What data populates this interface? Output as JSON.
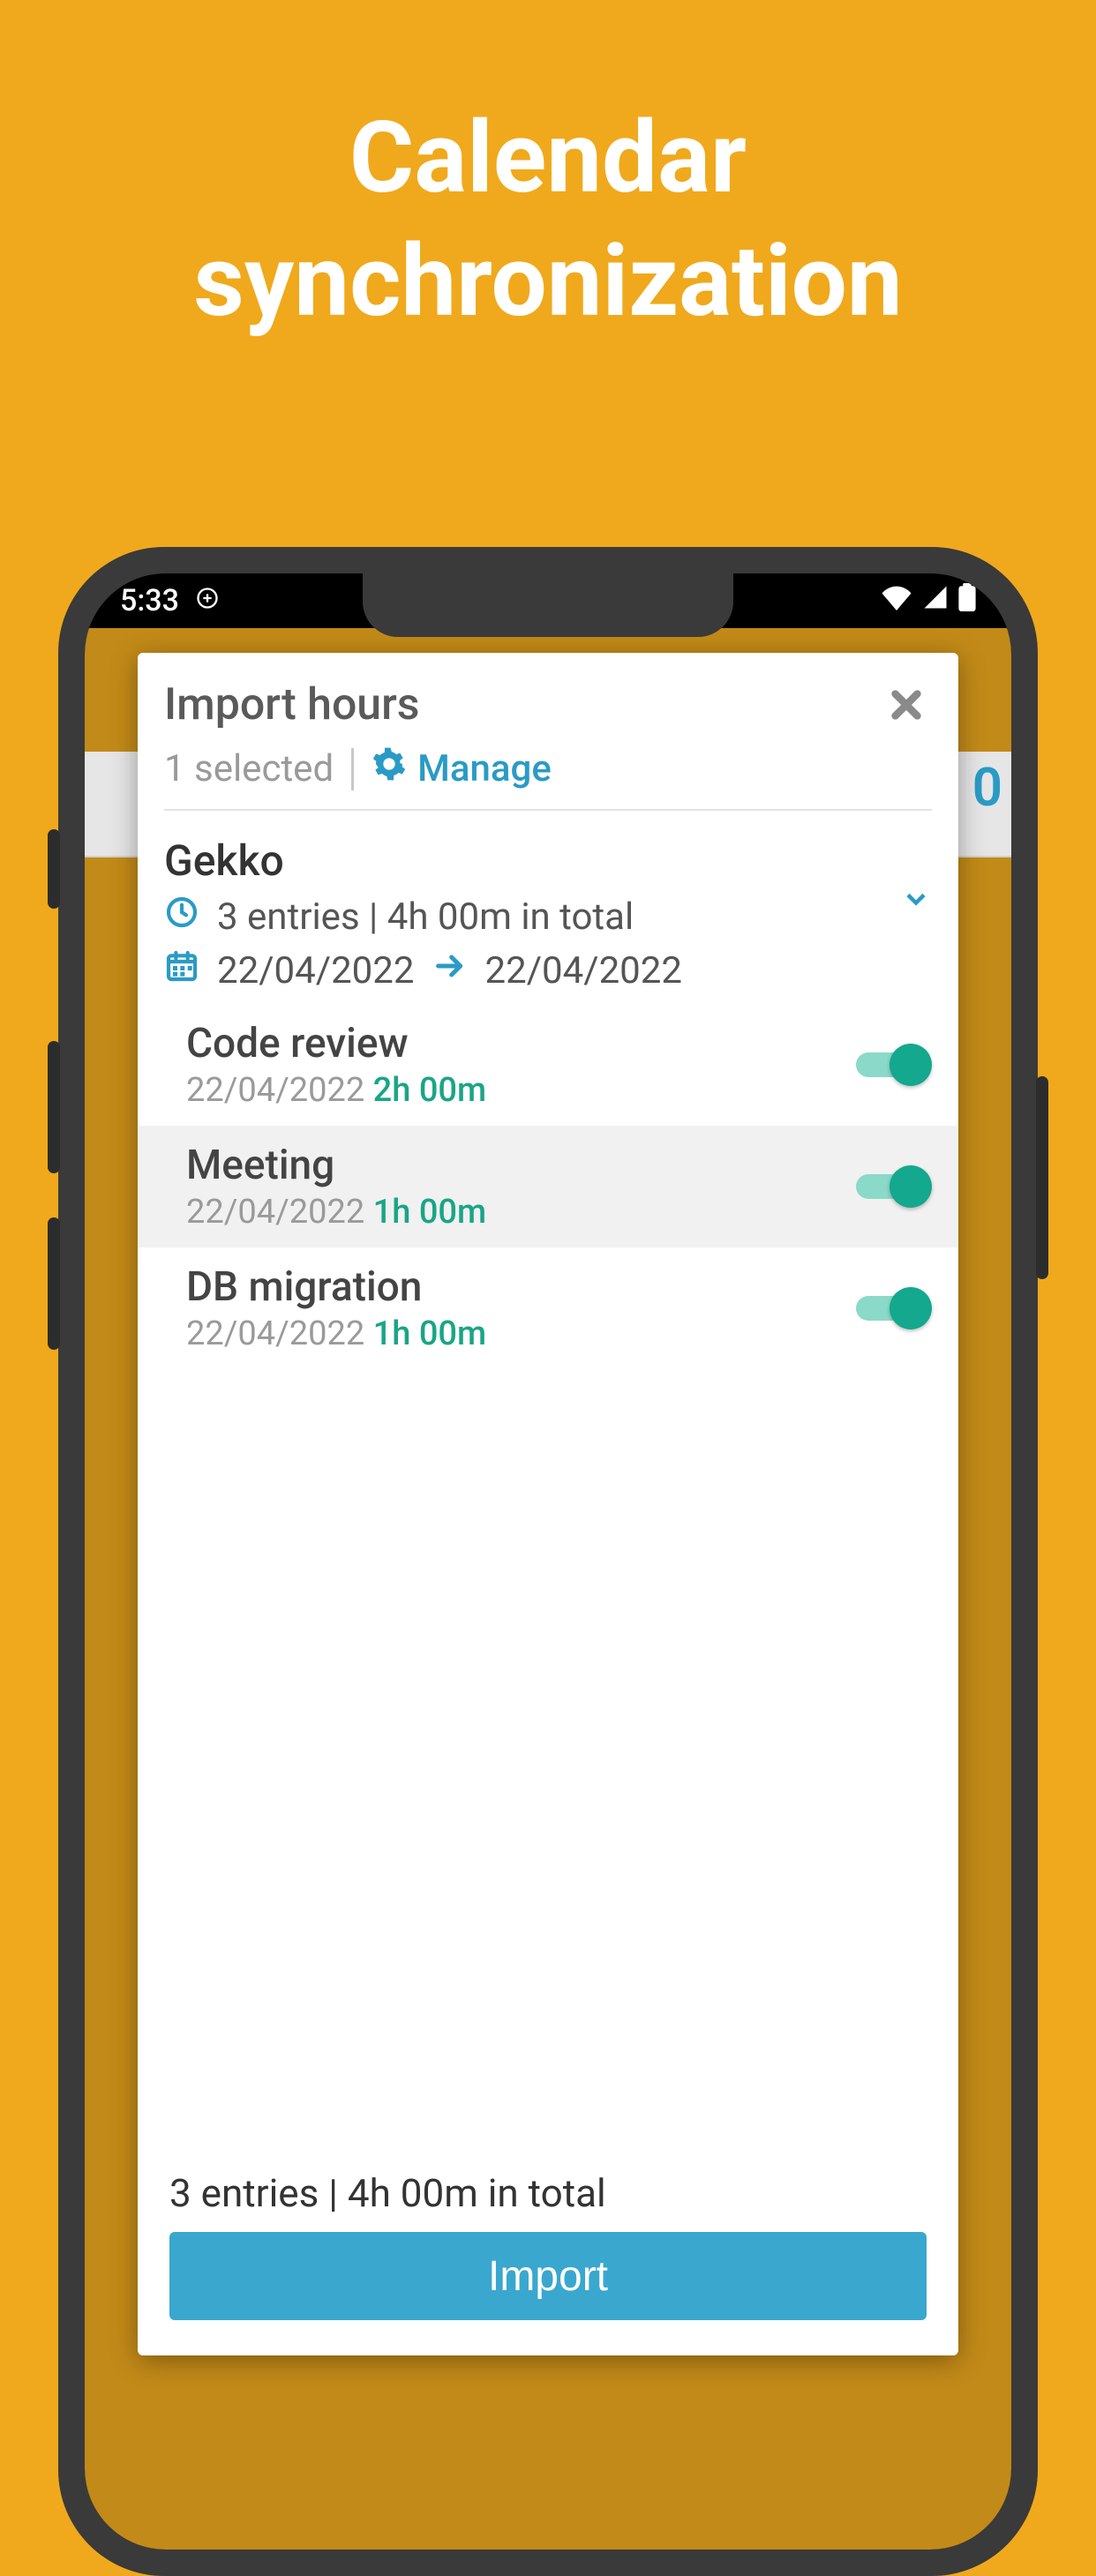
{
  "hero": {
    "line1": "Calendar",
    "line2": "synchronization"
  },
  "status_bar": {
    "time": "5:33"
  },
  "modal": {
    "title": "Import hours",
    "selected_text": "1 selected",
    "manage_label": "Manage",
    "project": {
      "name": "Gekko",
      "summary": "3 entries | 4h 00m in total",
      "date_from": "22/04/2022",
      "date_to": "22/04/2022"
    },
    "entries": [
      {
        "title": "Code review",
        "date": "22/04/2022",
        "duration": "2h 00m",
        "enabled": true
      },
      {
        "title": "Meeting",
        "date": "22/04/2022",
        "duration": "1h 00m",
        "enabled": true
      },
      {
        "title": "DB migration",
        "date": "22/04/2022",
        "duration": "1h 00m",
        "enabled": true
      }
    ],
    "footer_summary": "3 entries | 4h 00m in total",
    "import_button": "Import"
  }
}
